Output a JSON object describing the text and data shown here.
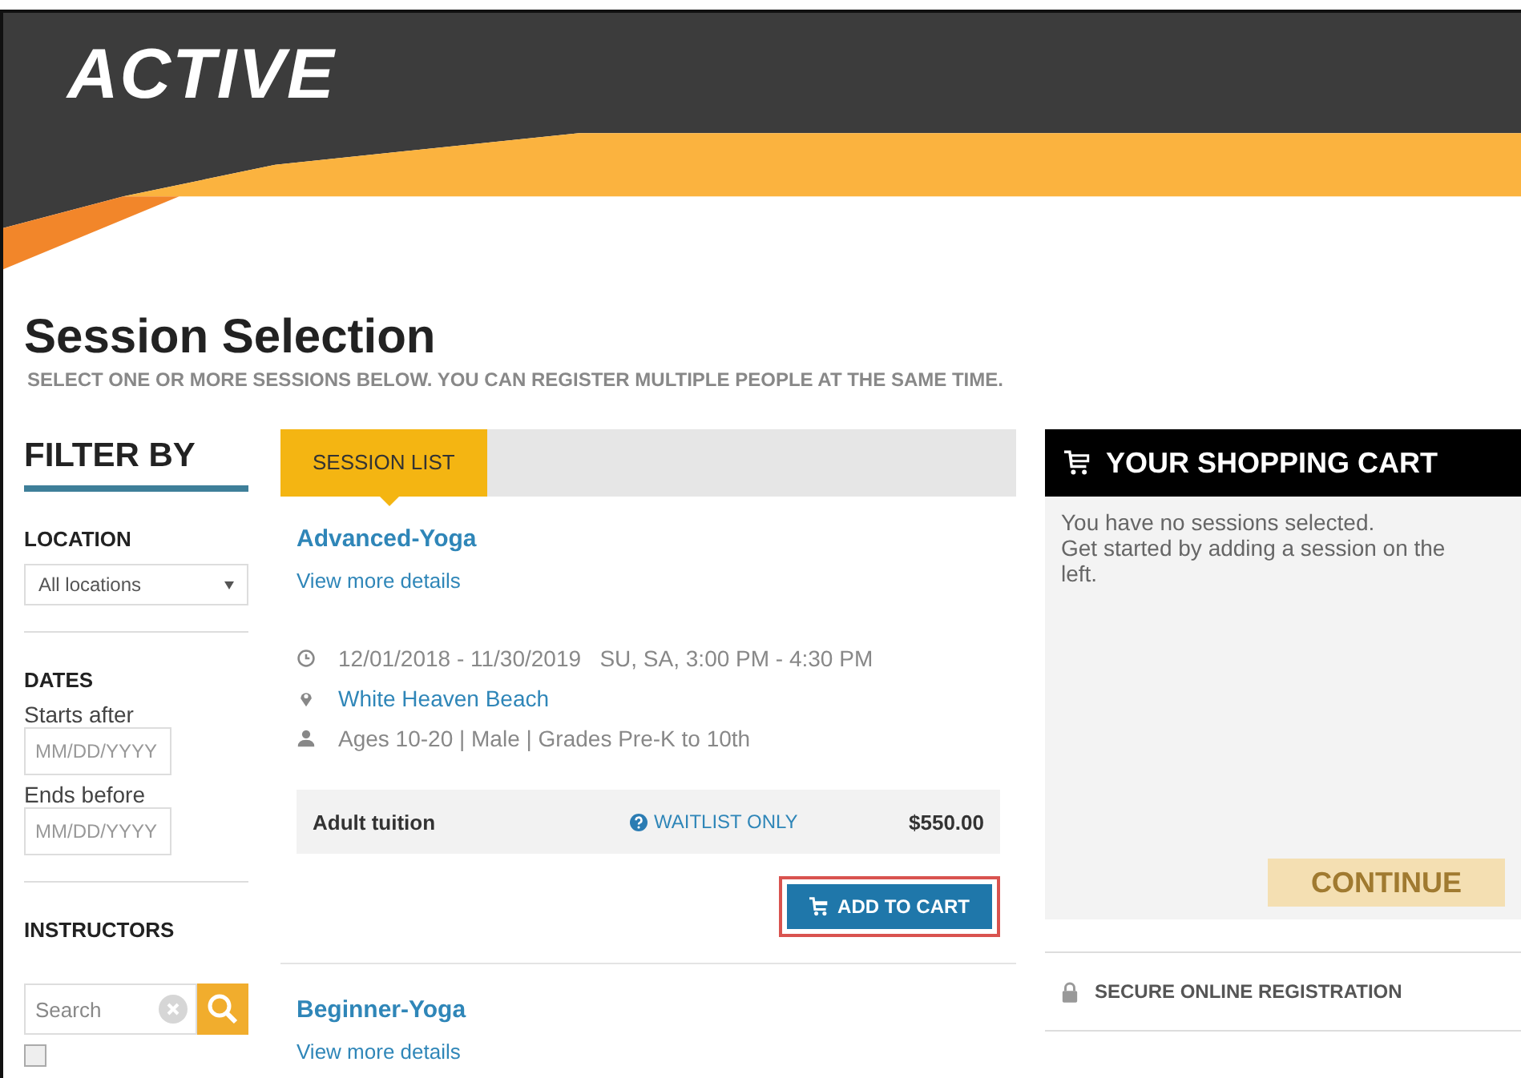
{
  "header": {
    "logo": "ACTIVE"
  },
  "page": {
    "title": "Session Selection",
    "subtitle": "SELECT ONE OR MORE SESSIONS BELOW. YOU CAN REGISTER MULTIPLE PEOPLE AT THE SAME TIME."
  },
  "filters": {
    "title": "FILTER BY",
    "location": {
      "label": "LOCATION",
      "value": "All locations"
    },
    "dates": {
      "label": "DATES",
      "fields": [
        {
          "label": "Starts after",
          "placeholder": "MM/DD/YYYY"
        },
        {
          "label": "Ends before",
          "placeholder": "MM/DD/YYYY"
        }
      ]
    },
    "instructors": {
      "label": "INSTRUCTORS",
      "search": {
        "placeholder": "Search"
      },
      "options": [
        {
          "checked": false
        }
      ]
    }
  },
  "tabs": [
    {
      "label": "SESSION LIST",
      "selected": true
    }
  ],
  "sessions": [
    {
      "name": "Advanced-Yoga",
      "link": "View more details",
      "schedule": "12/01/2018 - 11/30/2019   SU, SA, 3:00 PM - 4:30 PM",
      "location": "White Heaven Beach",
      "eligibility": "Ages 10-20 | Male | Grades Pre-K to 10th",
      "fee": {
        "name": "Adult tuition",
        "status": "WAITLIST ONLY",
        "price": "$550.00"
      },
      "button": {
        "label": "ADD TO CART",
        "highlighted": true
      }
    },
    {
      "name": "Beginner-Yoga",
      "link": "View more details"
    }
  ],
  "cart": {
    "title": "YOUR SHOPPING CART",
    "message": "You have no sessions selected.\nGet started by adding a session on the left.",
    "button": {
      "label": "CONTINUE",
      "disabled": true
    },
    "secure": "SECURE ONLINE REGISTRATION"
  }
}
